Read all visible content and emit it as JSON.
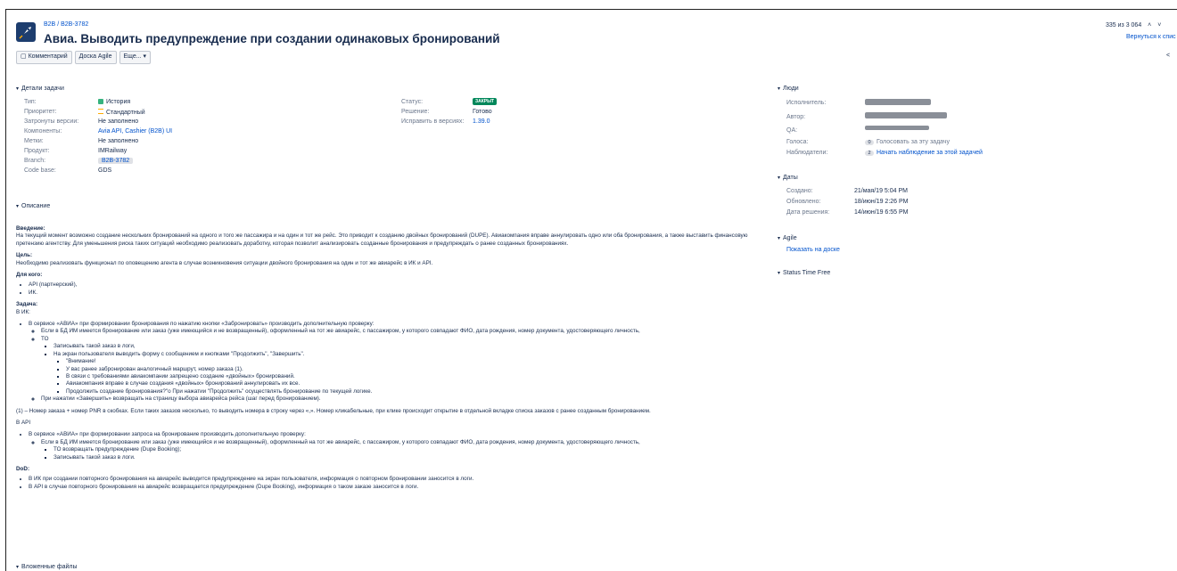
{
  "header": {
    "breadcrumb_project": "B2B",
    "breadcrumb_sep": "/",
    "breadcrumb_issue": "B2B-3782",
    "title": "Авиа. Выводить предупреждение при создании одинаковых бронирований",
    "counter": "335 из 3 064",
    "back_link": "Вернуться к спис"
  },
  "toolbar": {
    "comment_label": "Комментарий",
    "agile_label": "Доска Agile",
    "more_label": "Еще..."
  },
  "details": {
    "heading": "Детали задачи",
    "left": [
      {
        "label": "Тип:",
        "value": "История"
      },
      {
        "label": "Приоритет:",
        "value": "Стандартный"
      },
      {
        "label": "Затронуты версии:",
        "value": "Не заполнено"
      },
      {
        "label": "Компоненты:",
        "value": "Avia API, Cashier (B2B) UI"
      },
      {
        "label": "Метки:",
        "value": "Не заполнено"
      },
      {
        "label": "Продукт:",
        "value": "IMRailway"
      },
      {
        "label": "Branch:",
        "value": "B2B-3782"
      },
      {
        "label": "Code base:",
        "value": "GDS"
      }
    ],
    "right": [
      {
        "label": "Статус:",
        "value": "ЗАКРЫТ"
      },
      {
        "label": "Решение:",
        "value": "Готово"
      },
      {
        "label": "Исправить в версиях:",
        "value": "1.39.0"
      }
    ]
  },
  "people": {
    "heading": "Люди",
    "executor_label": "Исполнитель:",
    "author_label": "Автор:",
    "qa_label": "QA:",
    "votes_label": "Голоса:",
    "votes_count": "0",
    "votes_action": "Голосовать за эту задачу",
    "watchers_label": "Наблюдатели:",
    "watchers_count": "2",
    "watchers_action": "Начать наблюдение за этой задачей"
  },
  "dates": {
    "heading": "Даты",
    "created_label": "Создано:",
    "created_value": "21/мая/19 5:04 PM",
    "updated_label": "Обновлено:",
    "updated_value": "18/июн/19 2:26 PM",
    "resolved_label": "Дата решения:",
    "resolved_value": "14/июн/19 6:55 PM"
  },
  "agile": {
    "heading": "Agile",
    "link": "Показать на доске"
  },
  "status_time": {
    "heading": "Status Time Free"
  },
  "description": {
    "heading": "Описание",
    "intro_h": "Введение:",
    "intro_text": "На текущий момент возможно создание нескольких бронирований на одного и того же пассажира и на один и тот же рейс. Это приводит к созданию двойных бронирований (DUPE). Авиакомпания вправе аннулировать одно или оба бронирования, а также выставить финансовую претензию агентству. Для уменьшения риска таких ситуаций необходимо реализовать доработку, которая позволит анализировать созданные бронирования и предупреждать о ранее созданных бронированиях.",
    "goals_h": "Цель:",
    "goals_text": "Необходимо реализовать функционал по оповещению агента в случае возникновения ситуации двойного бронирования на один и тот же авиарейс в ИК и API.",
    "for_h": "Для кого:",
    "for_items": [
      "API (партнерский),",
      "ИК."
    ],
    "task_h": "Задача:",
    "task_ik": "В ИК:",
    "ik_1": "В сервисе «АВИА» при формировании бронирования по нажатию кнопки «Забронировать» производить дополнительную проверку:",
    "ik_1_a": "Если в БД ИМ имеется бронирование или заказ (уже имеющийся и не возвращенный), оформленный на тот же авиарейс, с пассажиром, у которого совпадают ФИО, дата рождения, номер документа, удостоверяющего личность,",
    "ik_1_b": "ТО",
    "ik_1_b_1": "Записывать такой заказ в логи,",
    "ik_1_b_2": "На экран пользователя выводить форму с сообщением и кнопками \"Продолжить\", \"Завершить\".",
    "msg_1": "\"Внимание!",
    "msg_2": "У вас ранее забронирован аналогичный маршрут, номер заказа (1).",
    "msg_3": "В связи с требованиями авиакомпании запрещено создание «двойных» бронирований.",
    "msg_4": "Авиакомпания вправе в случае создания «двойных» бронирований аннулировать их все.",
    "msg_5": "Продолжить создание бронирования?\"о При нажатии \"Продолжить\" осуществлять бронирование по текущей логике.",
    "ik_1_c": "При нажатии «Завершить» возвращать на страницу выбора авиарейса рейса (шаг перед бронированием).",
    "footnote": "(1) – Номер заказа + номер PNR в скобках. Если таких заказов несколько, то выводить номера в строку через «,». Номер кликабельные, при клике происходит открытие в отдельной вкладке списка заказов с ранее созданным бронированием.",
    "task_api": "В API",
    "api_1": "В сервисе «АВИА» при формировании запроса на бронирование производить дополнительную проверку:",
    "api_1_a": "Если в БД ИМ имеется бронирование или заказ (уже имеющийся и не возвращенный), оформленный на тот же авиарейс, с пассажиром, у которого совпадают ФИО, дата рождения, номер документа, удостоверяющего личность,",
    "api_1_a_1": "ТО возвращать предупреждение (Dupe Booking);",
    "api_1_a_2": "Записывать такой заказ в логи.",
    "dod_h": "DoD:",
    "dod_1": "В ИК при создании повторного бронирования на авиарейс выводится предупреждение на экран пользователя, информация о повторном бронировании заносится в логи.",
    "dod_2": "В API в случае повторного бронирования на авиарейс возвращается предупреждение (Dupe Booking), информация о таком заказе заносится в логи."
  },
  "attachments": {
    "heading": "Вложенные файлы"
  }
}
